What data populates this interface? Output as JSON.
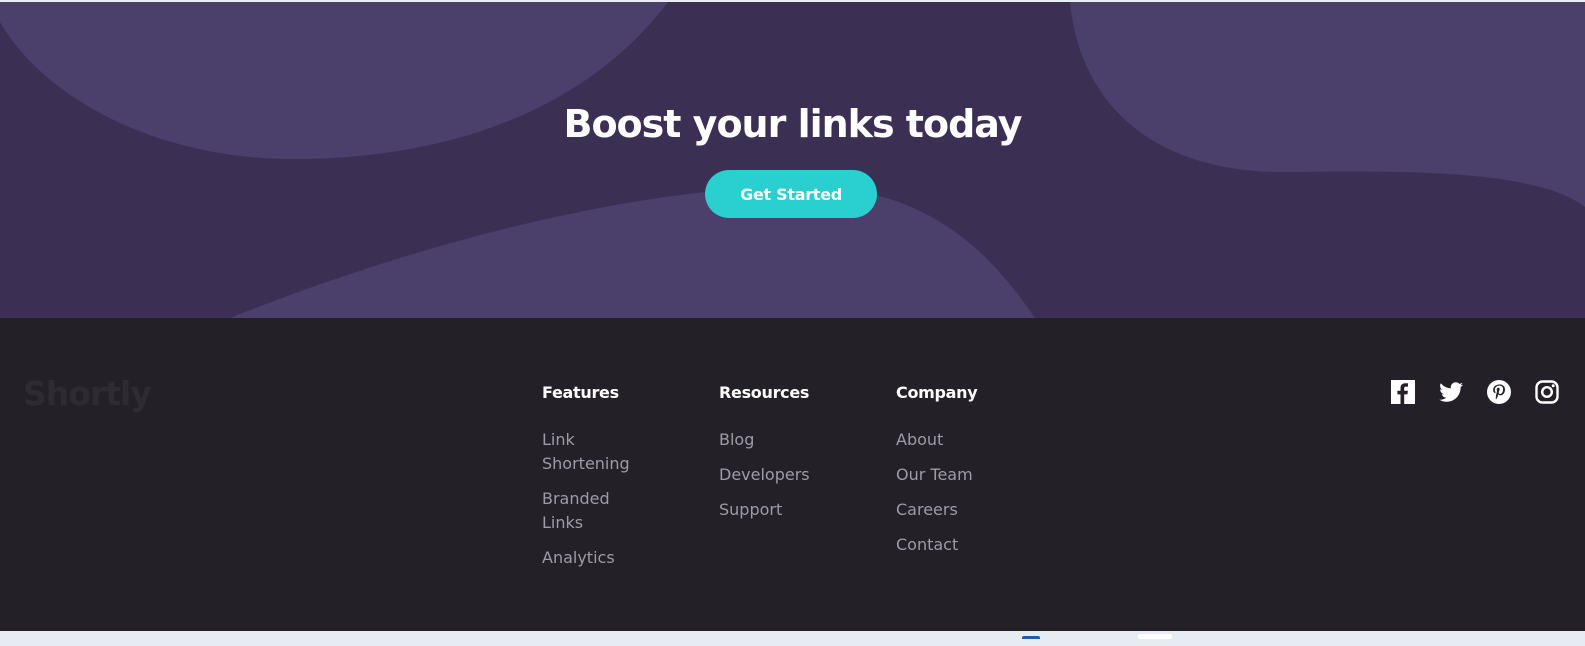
{
  "boost": {
    "title": "Boost your links today",
    "cta_label": "Get Started"
  },
  "footer": {
    "logo": "Shortly",
    "columns": [
      {
        "title": "Features",
        "links": [
          "Link Shortening",
          "Branded Links",
          "Analytics"
        ]
      },
      {
        "title": "Resources",
        "links": [
          "Blog",
          "Developers",
          "Support"
        ]
      },
      {
        "title": "Company",
        "links": [
          "About",
          "Our Team",
          "Careers",
          "Contact"
        ]
      }
    ],
    "socials": [
      "facebook-icon",
      "twitter-icon",
      "pinterest-icon",
      "instagram-icon"
    ]
  },
  "colors": {
    "boost_bg": "#3b3054",
    "boost_shape": "#4b3f6b",
    "cta": "#2acfcf",
    "footer_bg": "#232127",
    "link": "#9e9aa7",
    "logo": "#2e2b33"
  }
}
